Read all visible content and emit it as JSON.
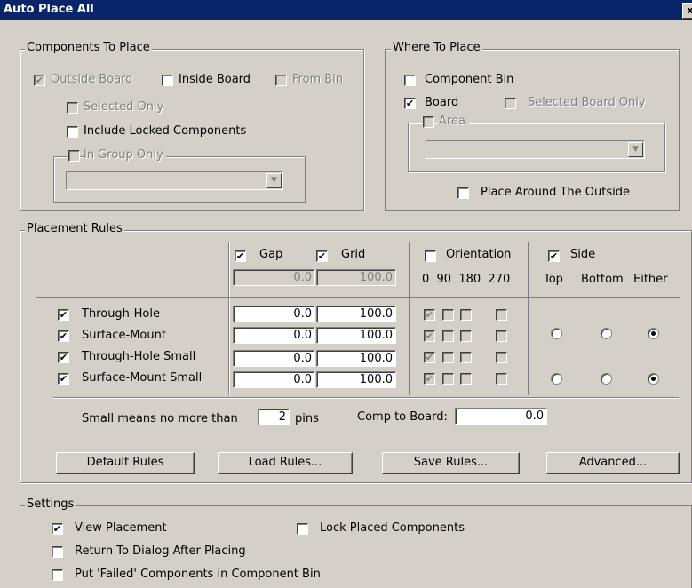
{
  "window": {
    "title": "Auto Place All",
    "close_glyph": "x"
  },
  "components": {
    "legend": "Components To Place",
    "outside_board": "Outside Board",
    "inside_board": "Inside Board",
    "from_bin": "From Bin",
    "selected_only": "Selected Only",
    "include_locked": "Include Locked Components",
    "in_group_only": "In Group Only",
    "group_value": ""
  },
  "where": {
    "legend": "Where To Place",
    "component_bin": "Component Bin",
    "board": "Board",
    "selected_board_only": "Selected Board Only",
    "area": "Area",
    "area_value": "",
    "place_around": "Place Around The Outside"
  },
  "rules": {
    "legend": "Placement Rules",
    "gap": "Gap",
    "grid": "Grid",
    "gap_default": "0.0",
    "grid_default": "100.0",
    "orientation": "Orientation",
    "orient_angles": "0  90  180  270",
    "side": "Side",
    "side_options": [
      "Top",
      "Bottom",
      "Either"
    ],
    "rows": [
      {
        "label": "Through-Hole",
        "gap": "0.0",
        "grid": "100.0"
      },
      {
        "label": "Surface-Mount",
        "gap": "0.0",
        "grid": "100.0"
      },
      {
        "label": "Through-Hole Small",
        "gap": "0.0",
        "grid": "100.0"
      },
      {
        "label": "Surface-Mount Small",
        "gap": "0.0",
        "grid": "100.0"
      }
    ],
    "small_prefix": "Small means no more than",
    "small_pins": "2",
    "pins_suffix": "pins",
    "comp_to_board": "Comp to Board:",
    "comp_to_board_value": "0.0",
    "buttons": {
      "default": "Default Rules",
      "load": "Load Rules...",
      "save": "Save Rules...",
      "advanced": "Advanced..."
    }
  },
  "settings": {
    "legend": "Settings",
    "view_placement": "View Placement",
    "lock_placed": "Lock Placed Components",
    "return_to_dialog": "Return To Dialog After Placing",
    "put_failed": "Put 'Failed' Components in Component Bin"
  },
  "checkmark": "✔"
}
